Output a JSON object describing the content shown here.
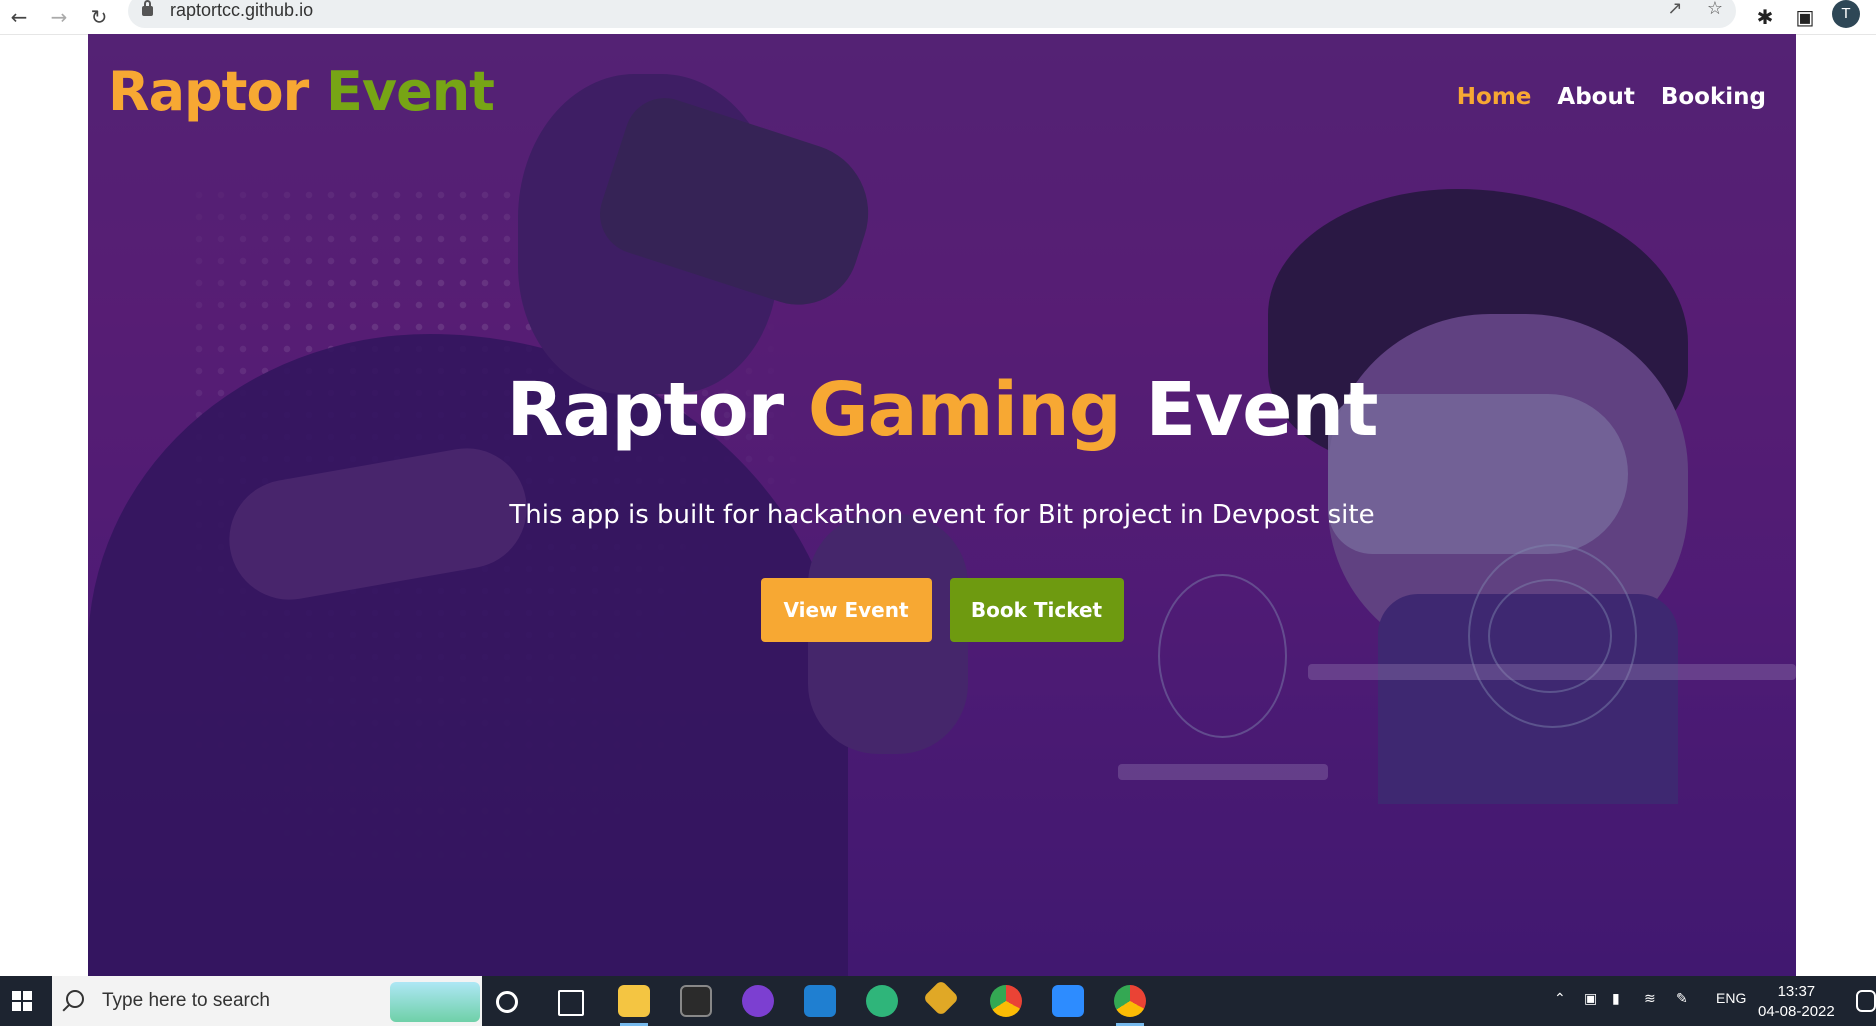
{
  "browser": {
    "url": "raptortcc.github.io",
    "back_icon": "arrow-left-icon",
    "forward_icon": "arrow-right-icon",
    "reload_icon": "reload-icon",
    "profile_initial": "T"
  },
  "header": {
    "logo_part1": "Raptor",
    "logo_part2": "Event",
    "nav": [
      {
        "label": "Home",
        "active": true
      },
      {
        "label": "About",
        "active": false
      },
      {
        "label": "Booking",
        "active": false
      }
    ]
  },
  "hero": {
    "title_part1": "Raptor",
    "title_highlight": "Gaming",
    "title_part2": "Event",
    "subtitle": "This app is built for hackathon event for Bit project in Devpost site",
    "buttons": {
      "view_event": "View Event",
      "book_ticket": "Book Ticket"
    }
  },
  "taskbar": {
    "search_placeholder": "Type here to search",
    "language": "ENG",
    "time": "13:37",
    "date": "04-08-2022"
  },
  "colors": {
    "accent_orange": "#f7a833",
    "accent_green": "#6e9a10",
    "hero_purple": "#5c2a78"
  }
}
